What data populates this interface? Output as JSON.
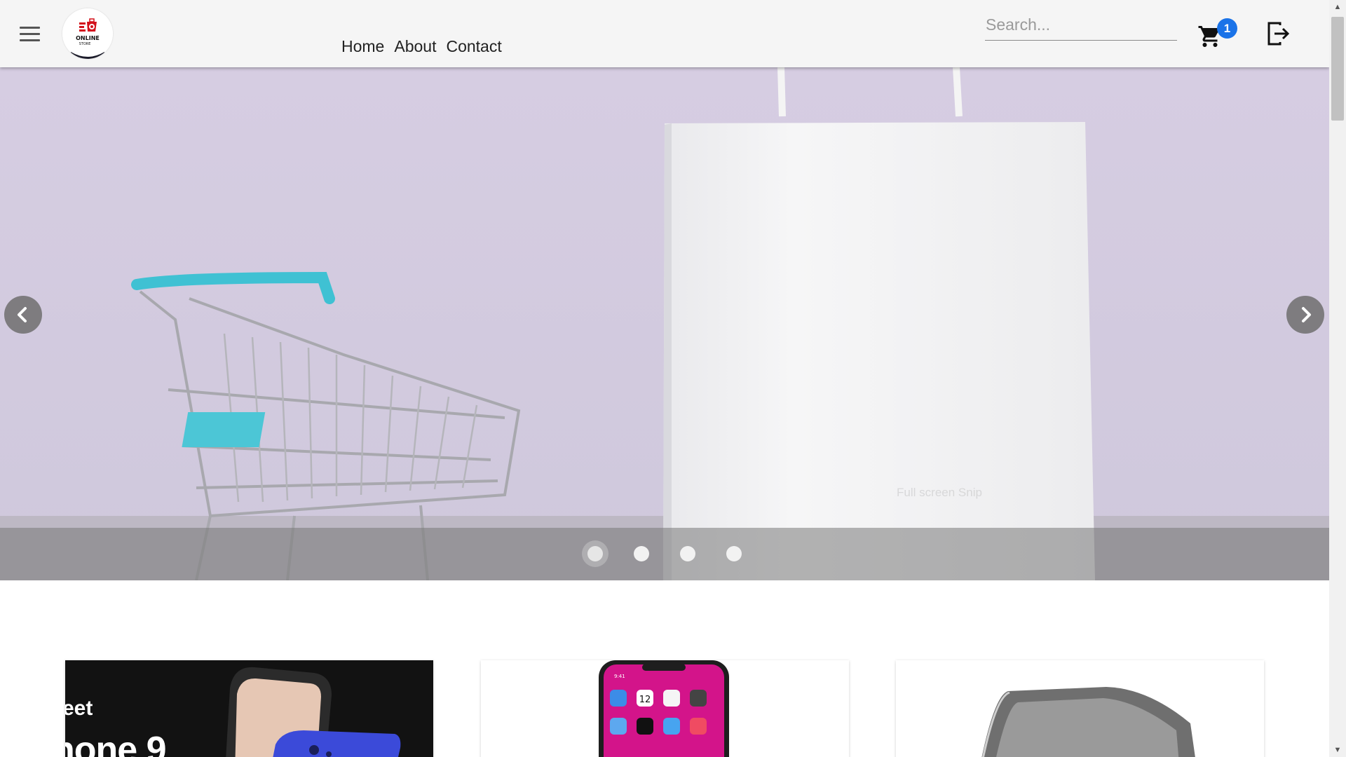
{
  "header": {
    "menu_icon": "hamburger-menu-icon",
    "logo": {
      "text_top": "ONLINE",
      "text_bottom": "STORE"
    },
    "nav": [
      {
        "label": "Home"
      },
      {
        "label": "About"
      },
      {
        "label": "Contact"
      }
    ],
    "search": {
      "placeholder": "Search...",
      "value": ""
    },
    "cart": {
      "icon": "shopping-cart-icon",
      "count": "1"
    },
    "logout_icon": "logout-icon"
  },
  "carousel": {
    "slide_count": 4,
    "active_index": 0,
    "overlay_text": "Full screen Snip",
    "prev_icon": "chevron-left-icon",
    "next_icon": "chevron-right-icon"
  },
  "products": [
    {
      "promo_line1": "eet",
      "promo_line2": "hone 9"
    },
    {
      "phone_date": "12",
      "phone_time": "9:41"
    },
    {}
  ],
  "colors": {
    "accent": "#1a73e8",
    "hero_bg": "#d8d0e3",
    "cart_teal": "#3fc1d3"
  }
}
